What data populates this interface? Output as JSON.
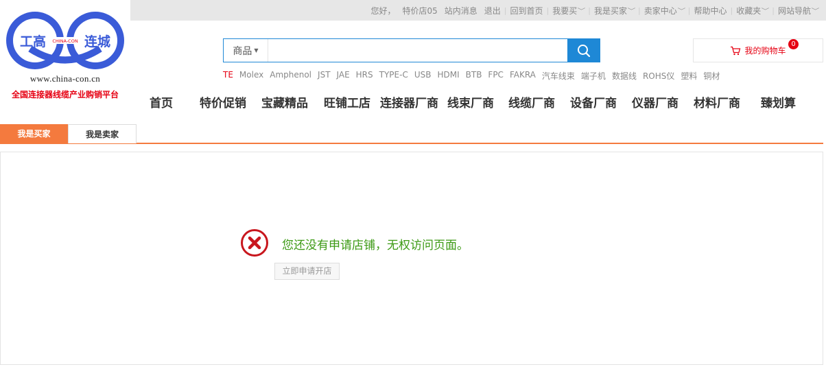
{
  "topbar": {
    "greeting": "您好，",
    "username": "特价店05",
    "messages": "站内消息",
    "logout": "退出",
    "home": "回到首页",
    "buy": "我要买",
    "buyer": "我是买家",
    "seller_center": "卖家中心",
    "help": "帮助中心",
    "favorites": "收藏夹",
    "site_nav": "网站导航"
  },
  "logo": {
    "left_text": "工高",
    "center_text": "CHINA-CON",
    "right_text": "连城",
    "url": "www.china-con.cn",
    "slogan": "全国连接器线缆产业购销平台",
    "colors": {
      "ring": "#3a5bd8",
      "red": "#e60012"
    }
  },
  "search": {
    "category": "商品",
    "placeholder": "",
    "value": "",
    "icon": "search-icon",
    "color": "#1e88d6"
  },
  "hotwords": [
    "TE",
    "Molex",
    "Amphenol",
    "JST",
    "JAE",
    "HRS",
    "TYPE-C",
    "USB",
    "HDMI",
    "BTB",
    "FPC",
    "FAKRA",
    "汽车线束",
    "端子机",
    "数据线",
    "ROHS仪",
    "塑料",
    "铜材"
  ],
  "cart": {
    "label": "我的购物车",
    "count": "0",
    "icon": "cart-icon"
  },
  "nav": {
    "items": [
      "首页",
      "特价促销",
      "宝藏精品",
      "旺铺工店",
      "连接器厂商",
      "线束厂商",
      "线缆厂商",
      "设备厂商",
      "仪器厂商",
      "材料厂商",
      "臻划算"
    ]
  },
  "tabs": {
    "buyer": "我是买家",
    "seller": "我是卖家",
    "active_color": "#f47a3e"
  },
  "message": {
    "text": "您还没有申请店铺，无权访问页面。",
    "button": "立即申请开店",
    "icon": "error-icon",
    "icon_color": "#c8161d",
    "text_color": "#3c9a14"
  }
}
